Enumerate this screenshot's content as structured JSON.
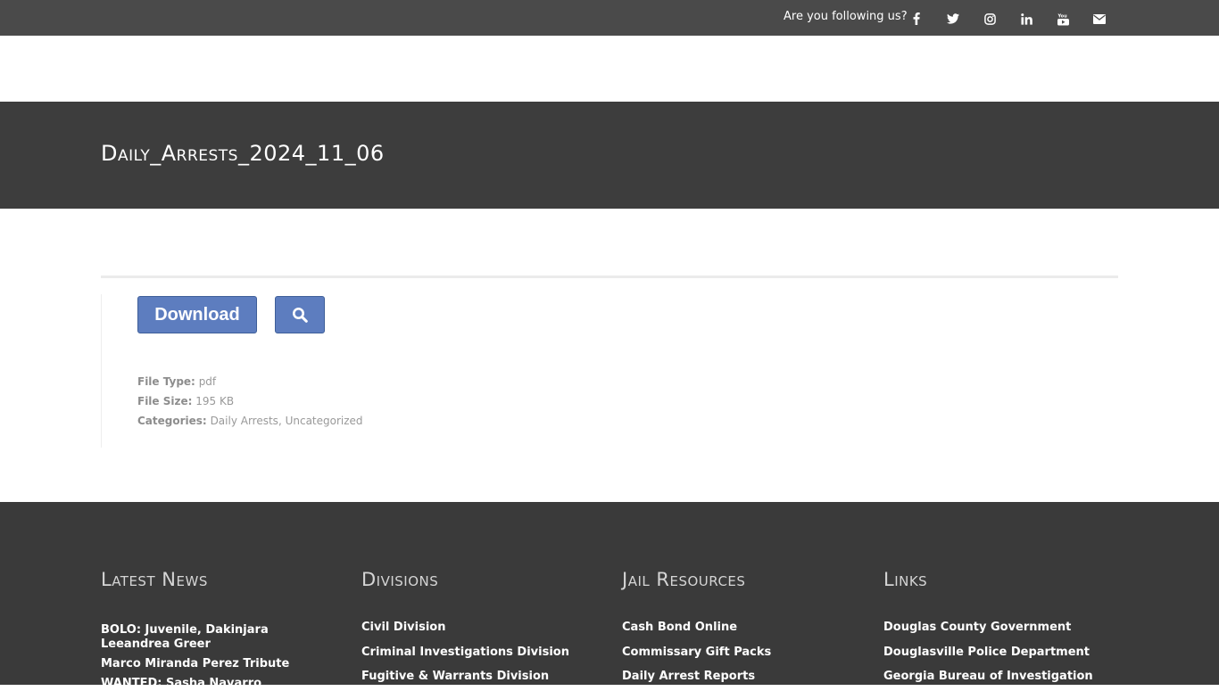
{
  "topbar": {
    "follow_text": "Are you following us?",
    "social": [
      {
        "name": "facebook-icon"
      },
      {
        "name": "twitter-icon"
      },
      {
        "name": "instagram-icon"
      },
      {
        "name": "linkedin-icon"
      },
      {
        "name": "youtube-icon"
      },
      {
        "name": "email-icon"
      }
    ]
  },
  "page": {
    "title": "Daily_Arrests_2024_11_06"
  },
  "file": {
    "download_label": "Download",
    "preview_icon": "search-icon",
    "type_label": "File Type:",
    "type_value": "pdf",
    "size_label": "File Size:",
    "size_value": "195 KB",
    "categories_label": "Categories:",
    "categories": [
      "Daily Arrests",
      "Uncategorized"
    ],
    "button_color": "#5d7dbf"
  },
  "footer": {
    "columns": [
      {
        "heading": "Latest News",
        "links": [
          "BOLO: Juvenile, Dakinjara Leeandrea Greer",
          "Marco Miranda Perez Tribute",
          "WANTED: Sasha Navarro"
        ]
      },
      {
        "heading": "Divisions",
        "links": [
          "Civil Division",
          "Criminal Investigations Division",
          "Fugitive & Warrants Division"
        ]
      },
      {
        "heading": "Jail Resources",
        "links": [
          "Cash Bond Online",
          "Commissary Gift Packs",
          "Daily Arrest Reports"
        ]
      },
      {
        "heading": "Links",
        "links": [
          "Douglas County Government",
          "Douglasville Police Department",
          "Georgia Bureau of Investigation"
        ]
      }
    ]
  },
  "colors": {
    "topbar": "#4a4a4a",
    "title_band": "#3d3d3d",
    "footer": "#3a3a3a",
    "accent": "#5d7dbf"
  }
}
